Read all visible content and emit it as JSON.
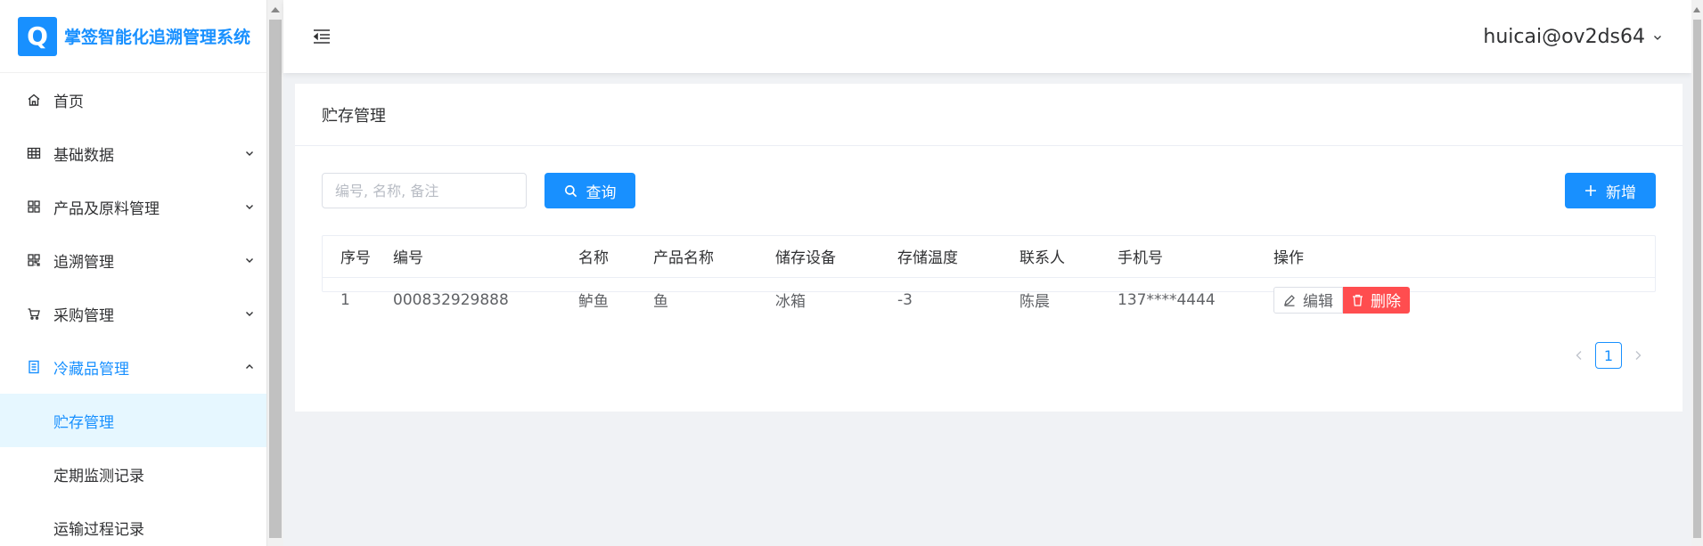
{
  "app": {
    "logo_glyph": "Q",
    "title": "掌签智能化追溯管理系统",
    "accent_color": "#1890ff",
    "danger_color": "#ff4d4f"
  },
  "sidebar": {
    "items": [
      {
        "label": "首页",
        "icon": "home-icon"
      },
      {
        "label": "基础数据",
        "icon": "grid-icon"
      },
      {
        "label": "产品及原料管理",
        "icon": "apps-icon"
      },
      {
        "label": "追溯管理",
        "icon": "qrcode-icon"
      },
      {
        "label": "采购管理",
        "icon": "cart-icon"
      },
      {
        "label": "冷藏品管理",
        "icon": "document-icon"
      }
    ],
    "sub_items": [
      {
        "label": "贮存管理",
        "active": true
      },
      {
        "label": "定期监测记录",
        "active": false
      },
      {
        "label": "运输过程记录",
        "active": false
      }
    ]
  },
  "header": {
    "user": "huicai@ov2ds64"
  },
  "page": {
    "title": "贮存管理",
    "search_placeholder": "编号, 名称, 备注",
    "search_value": "",
    "query_label": "查询",
    "add_label": "新增"
  },
  "table": {
    "columns": [
      "序号",
      "编号",
      "名称",
      "产品名称",
      "储存设备",
      "存储温度",
      "联系人",
      "手机号",
      "操作"
    ],
    "rows": [
      {
        "index": "1",
        "code": "000832929888",
        "name": "鲈鱼",
        "product": "鱼",
        "device": "冰箱",
        "temperature": "-3",
        "contact": "陈晨",
        "phone": "137****4444",
        "edit_label": "编辑",
        "delete_label": "删除"
      }
    ]
  },
  "pagination": {
    "current_page": "1"
  }
}
